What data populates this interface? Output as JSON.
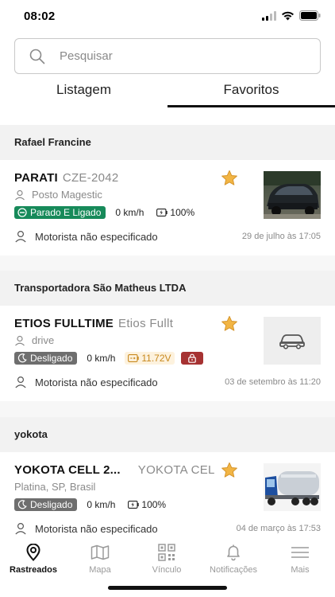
{
  "status_bar": {
    "time": "08:02"
  },
  "search": {
    "placeholder": "Pesquisar"
  },
  "tabs": [
    {
      "label": "Listagem",
      "active": false
    },
    {
      "label": "Favoritos",
      "active": true
    }
  ],
  "colors": {
    "status_green": "#178a5a",
    "status_grey": "#6e6e6e",
    "lock_red": "#a63232",
    "star_gold": "#f2b544",
    "battery_warn": "#c8891e"
  },
  "groups": [
    {
      "header": "Rafael Francine",
      "vehicle": {
        "name": "PARATI",
        "plate": "CZE-2042",
        "favorite": true,
        "location": "Posto Magestic",
        "location_icon": "person-pin-icon",
        "status": "Parado E Ligado",
        "status_icon": "minus-circle-icon",
        "speed": "0 km/h",
        "battery": "100%",
        "driver": "Motorista não especificado",
        "date": "29 de julho às 17:05",
        "image": "car-photo"
      }
    },
    {
      "header": "Transportadora São Matheus LTDA",
      "vehicle": {
        "name": "ETIOS FULLTIME",
        "plate": "Etios Fullt",
        "favorite": true,
        "location": "drive",
        "location_icon": "person-pin-icon",
        "status": "Desligado",
        "status_icon": "moon-icon",
        "speed": "0 km/h",
        "battery": "11.72V",
        "locked": true,
        "driver": "Motorista não especificado",
        "date": "03 de setembro às 11:20",
        "image": "car-placeholder-icon"
      }
    },
    {
      "header": "yokota",
      "vehicle": {
        "name": "YOKOTA CELL 2...",
        "plate": "YOKOTA CEL",
        "favorite": true,
        "location": "Platina, SP, Brasil",
        "status": "Desligado",
        "status_icon": "moon-icon",
        "speed": "0 km/h",
        "battery": "100%",
        "driver": "Motorista não especificado",
        "date": "04 de março às 17:53",
        "image": "truck-photo"
      }
    }
  ],
  "bottom_nav": [
    {
      "label": "Rastreados",
      "icon": "location-pin-icon",
      "active": true
    },
    {
      "label": "Mapa",
      "icon": "map-icon",
      "active": false
    },
    {
      "label": "Vínculo",
      "icon": "qr-code-icon",
      "active": false
    },
    {
      "label": "Notificações",
      "icon": "bell-icon",
      "active": false
    },
    {
      "label": "Mais",
      "icon": "menu-icon",
      "active": false
    }
  ]
}
